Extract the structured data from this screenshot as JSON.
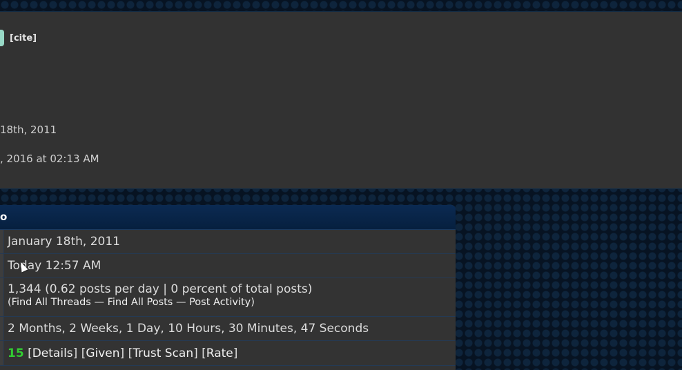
{
  "post": {
    "cite_label": "[cite]",
    "line1": "18th, 2011",
    "line2": ", 2016 at 02:13 AM"
  },
  "info": {
    "header": "o",
    "joined": "January 18th, 2011",
    "last_visit": "Today 12:57 AM",
    "posts": "1,344 (0.62 posts per day | 0 percent of total posts)",
    "links": {
      "open": "(",
      "find_threads": "Find All Threads",
      "sep1": " — ",
      "find_posts": "Find All Posts",
      "sep2": " — ",
      "post_activity": "Post Activity",
      "close": ")"
    },
    "time_online": "2 Months, 2 Weeks, 1 Day, 10 Hours, 30 Minutes, 47 Seconds",
    "reputation": {
      "value": "15",
      "details": "Details",
      "given": "Given",
      "trust_scan": "Trust Scan",
      "rate": "Rate"
    }
  }
}
